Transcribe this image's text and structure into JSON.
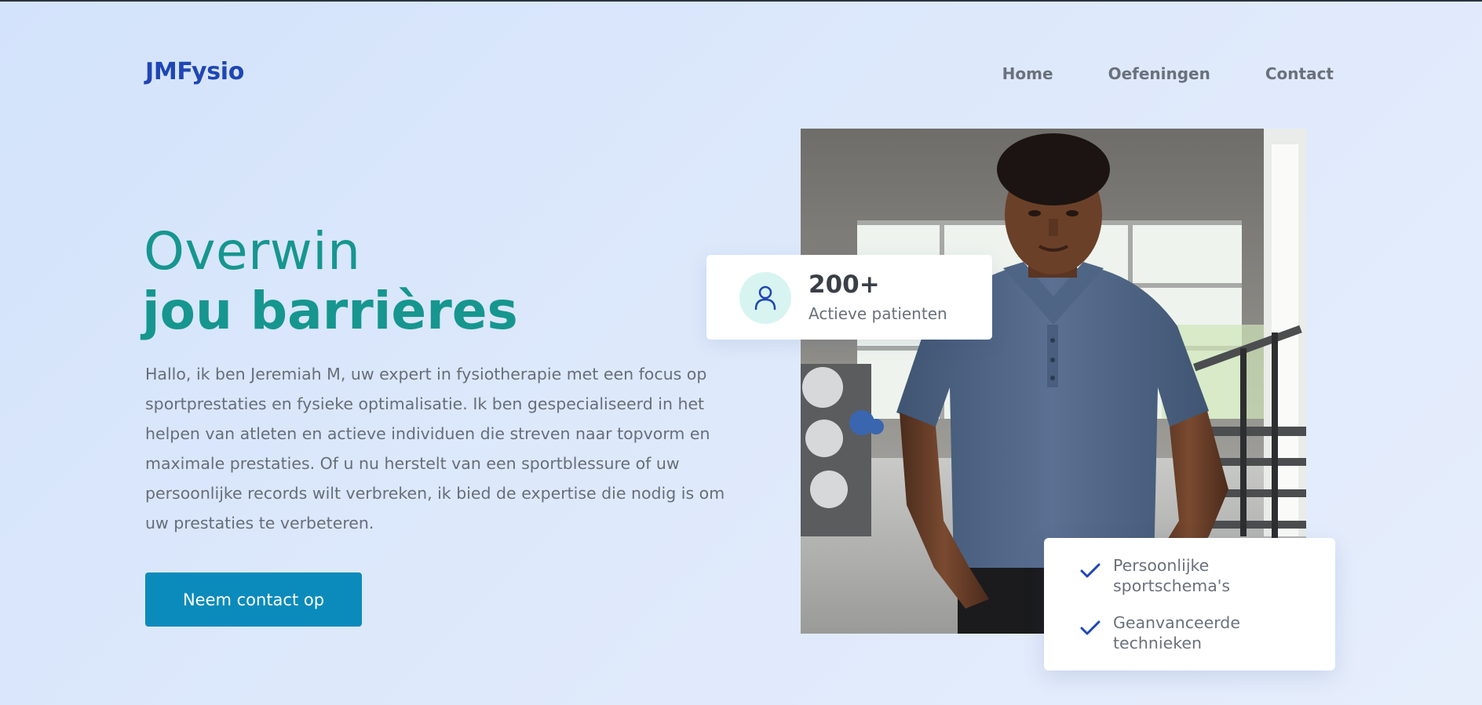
{
  "brand": {
    "name": "JMFysio"
  },
  "nav": {
    "items": [
      "Home",
      "Oefeningen",
      "Contact"
    ]
  },
  "hero": {
    "title_line1": "Overwin",
    "title_line2": "jou barrières",
    "text": "Hallo, ik ben Jeremiah M, uw expert in fysiotherapie met een focus op sportprestaties en fysieke optimalisatie. Ik ben gespecialiseerd in het helpen van atleten en actieve individuen die streven naar topvorm en maximale prestaties. Of u nu herstelt van een sportblessure of uw persoonlijke records wilt verbreken, ik bied de expertise die nodig is om uw prestaties te verbeteren.",
    "cta_label": "Neem contact op"
  },
  "stat": {
    "number": "200+",
    "label": "Actieve patienten",
    "icon": "user-icon"
  },
  "features": [
    {
      "label": "Persoonlijke sportschema's",
      "icon": "check-icon"
    },
    {
      "label": "Geanvanceerde technieken",
      "icon": "check-icon"
    }
  ],
  "colors": {
    "brand": "#1f46b4",
    "accent_teal": "#16968f",
    "button": "#0b8bbb",
    "text_muted": "#676e79"
  }
}
